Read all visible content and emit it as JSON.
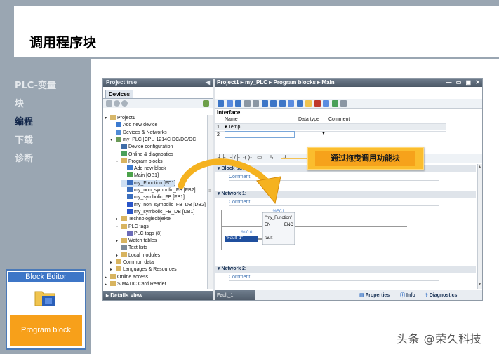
{
  "slide": {
    "title": "调用程序块",
    "nav": [
      "PLC-变量",
      "块",
      "编程",
      "下载",
      "诊断"
    ],
    "active_nav": "编程",
    "block_editor_card": {
      "title": "Block  Editor",
      "bottom_label": "Program block"
    },
    "watermark": "头条 @荣久科技"
  },
  "tia": {
    "project_tree": {
      "header": "Project tree",
      "devices_tab": "Devices",
      "details_view": "Details view",
      "items": [
        {
          "label": "Project1",
          "expander": "▾",
          "icon": "project-icon",
          "color": "#d7b76a"
        },
        {
          "label": "Add new device",
          "expander": "",
          "icon": "add-device-icon",
          "color": "#3b7ad0"
        },
        {
          "label": "Devices & Networks",
          "expander": "",
          "icon": "network-icon",
          "color": "#4f8bd6"
        },
        {
          "label": "my_PLC [CPU 1214C DC/DC/DC]",
          "expander": "▾",
          "icon": "plc-icon",
          "color": "#6a9a57"
        },
        {
          "label": "Device configuration",
          "expander": "",
          "icon": "device-config-icon",
          "color": "#3f6ea8"
        },
        {
          "label": "Online & diagnostics",
          "expander": "",
          "icon": "diagnostics-icon",
          "color": "#4aa05a"
        },
        {
          "label": "Program blocks",
          "expander": "▾",
          "icon": "folder-icon",
          "color": "#d8b460"
        },
        {
          "label": "Add new block",
          "expander": "",
          "icon": "add-block-icon",
          "color": "#3b7ad0"
        },
        {
          "label": "Main [OB1]",
          "expander": "",
          "icon": "ob-icon",
          "color": "#4ca24a"
        },
        {
          "label": "my_Function [FC1]",
          "expander": "",
          "icon": "fc-icon",
          "color": "#3b6fbf",
          "selected": true
        },
        {
          "label": "my_non_symbolic_FB [FB2]",
          "expander": "",
          "icon": "fb-icon",
          "color": "#3b6fbf"
        },
        {
          "label": "my_symbolic_FB [FB1]",
          "expander": "",
          "icon": "fb-icon",
          "color": "#3b6fbf"
        },
        {
          "label": "my_non_symbolic_FB_DB [DB2]",
          "expander": "",
          "icon": "db-icon",
          "color": "#2a55c8"
        },
        {
          "label": "my_symbolic_FB_DB [DB1]",
          "expander": "",
          "icon": "db-icon",
          "color": "#2a55c8"
        },
        {
          "label": "Technologieobjekte",
          "expander": "▸",
          "icon": "folder-icon",
          "color": "#d8b460"
        },
        {
          "label": "PLC tags",
          "expander": "▾",
          "icon": "folder-icon",
          "color": "#d8b460"
        },
        {
          "label": "PLC tags (8)",
          "expander": "",
          "icon": "tag-table-icon",
          "color": "#6b6bb8"
        },
        {
          "label": "Watch tables",
          "expander": "▸",
          "icon": "folder-icon",
          "color": "#d8b460"
        },
        {
          "label": "Text lists",
          "expander": "",
          "icon": "text-list-icon",
          "color": "#7d8b9a"
        },
        {
          "label": "Local modules",
          "expander": "▸",
          "icon": "folder-icon",
          "color": "#d8b460"
        },
        {
          "label": "Common data",
          "expander": "▸",
          "icon": "folder-icon",
          "color": "#d8b460"
        },
        {
          "label": "Languages & Resources",
          "expander": "▸",
          "icon": "folder-icon",
          "color": "#d8b460"
        },
        {
          "label": "Online access",
          "expander": "▸",
          "icon": "folder-icon",
          "color": "#d8b460"
        },
        {
          "label": "SIMATIC Card Reader",
          "expander": "▸",
          "icon": "folder-icon",
          "color": "#d8b460"
        }
      ]
    },
    "editor": {
      "breadcrumb": "Project1  ▸  my_PLC  ▸  Program blocks  ▸  Main",
      "interface_title": "Interface",
      "columns": [
        "Name",
        "Data type",
        "Comment"
      ],
      "rows": [
        {
          "num": "1",
          "name": "▾ Temp"
        },
        {
          "num": "2",
          "name": ""
        }
      ],
      "block_title": "Block title",
      "block_comment": "Comment",
      "network1": {
        "title": "Network 1:",
        "comment": "Comment"
      },
      "network2": {
        "title": "Network 2:",
        "comment": "Comment"
      },
      "fc_box": {
        "operand": "%FC1",
        "name": "\"my_Function\"",
        "en": "EN",
        "eno": "ENO",
        "param": "fault",
        "input_addr": "%I0.0",
        "input_tag": "\"Fault_1\""
      },
      "fault_tab": "Fault_1",
      "bottom_tabs": [
        "Properties",
        "Info",
        "Diagnostics"
      ]
    },
    "callout": "通过拖曳调用功能块",
    "colors": {
      "callout_fill": "#f6a21b",
      "arrow": "#f5b21f",
      "accent_blue": "#3d76c7"
    }
  }
}
